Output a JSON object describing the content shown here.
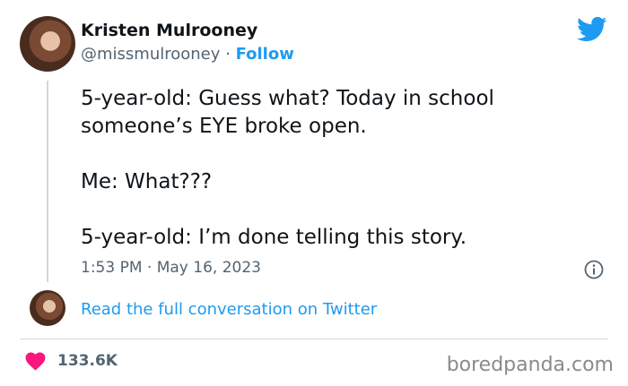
{
  "author": {
    "name": "Kristen Mulrooney",
    "handle": "@missmulrooney",
    "separator": " · ",
    "follow_label": "Follow"
  },
  "tweet": {
    "paragraphs": [
      "5-year-old: Guess what? Today in school\nsomeone’s EYE broke open.",
      "Me: What???",
      "5-year-old: I’m done telling this story."
    ],
    "timestamp": "1:53 PM · May 16, 2023"
  },
  "conversation_link": "Read the full conversation on Twitter",
  "likes": "133.6K",
  "watermark": "boredpanda.com",
  "colors": {
    "accent": "#1d9bf0",
    "heart": "#f91880",
    "text": "#0f1419",
    "muted": "#536471"
  },
  "icons": [
    "twitter-bird-icon",
    "info-icon",
    "heart-icon"
  ]
}
